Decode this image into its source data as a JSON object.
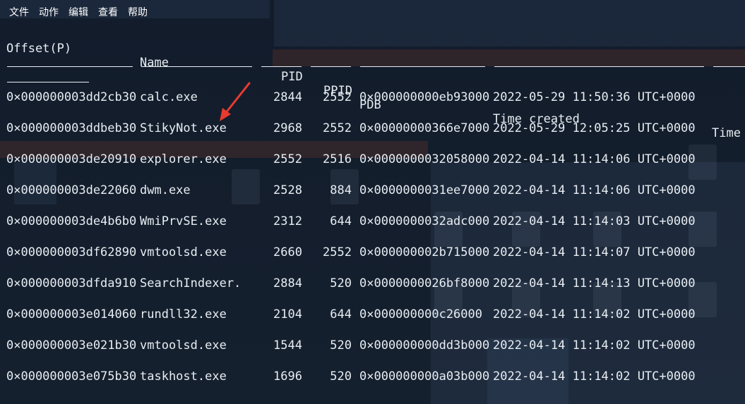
{
  "menu": {
    "items": [
      "文件",
      "动作",
      "编辑",
      "查看",
      "帮助"
    ]
  },
  "table": {
    "headers": {
      "offset": "Offset(P)",
      "name": "Name",
      "pid": "PID",
      "ppid": "PPID",
      "pdb": "PDB",
      "time_created": "Time created",
      "time_trunc": "Time"
    },
    "rows": [
      {
        "offset": "0×000000003dd2cb30",
        "name": "calc.exe",
        "pid": "2844",
        "ppid": "2552",
        "pdb": "0×000000000eb93000",
        "time": "2022-05-29 11:50:36 UTC+0000"
      },
      {
        "offset": "0×000000003ddbeb30",
        "name": "StikyNot.exe",
        "pid": "2968",
        "ppid": "2552",
        "pdb": "0×00000000366e7000",
        "time": "2022-05-29 12:05:25 UTC+0000"
      },
      {
        "offset": "0×000000003de20910",
        "name": "explorer.exe",
        "pid": "2552",
        "ppid": "2516",
        "pdb": "0×0000000032058000",
        "time": "2022-04-14 11:14:06 UTC+0000"
      },
      {
        "offset": "0×000000003de22060",
        "name": "dwm.exe",
        "pid": "2528",
        "ppid": "884",
        "pdb": "0×0000000031ee7000",
        "time": "2022-04-14 11:14:06 UTC+0000"
      },
      {
        "offset": "0×000000003de4b6b0",
        "name": "WmiPrvSE.exe",
        "pid": "2312",
        "ppid": "644",
        "pdb": "0×0000000032adc000",
        "time": "2022-04-14 11:14:03 UTC+0000"
      },
      {
        "offset": "0×000000003df62890",
        "name": "vmtoolsd.exe",
        "pid": "2660",
        "ppid": "2552",
        "pdb": "0×000000002b715000",
        "time": "2022-04-14 11:14:07 UTC+0000"
      },
      {
        "offset": "0×000000003dfda910",
        "name": "SearchIndexer.",
        "pid": "2884",
        "ppid": "520",
        "pdb": "0×0000000026bf8000",
        "time": "2022-04-14 11:14:13 UTC+0000"
      },
      {
        "offset": "0×000000003e014060",
        "name": "rundll32.exe",
        "pid": "2104",
        "ppid": "644",
        "pdb": "0×000000000c26000",
        "time": "2022-04-14 11:14:02 UTC+0000"
      },
      {
        "offset": "0×000000003e021b30",
        "name": "vmtoolsd.exe",
        "pid": "1544",
        "ppid": "520",
        "pdb": "0×000000000dd3b000",
        "time": "2022-04-14 11:14:02 UTC+0000"
      },
      {
        "offset": "0×000000003e075b30",
        "name": "taskhost.exe",
        "pid": "1696",
        "ppid": "520",
        "pdb": "0×000000000a03b000",
        "time": "2022-04-14 11:14:02 UTC+0000"
      }
    ]
  },
  "annotation": {
    "arrow_color": "#e83a2f"
  }
}
